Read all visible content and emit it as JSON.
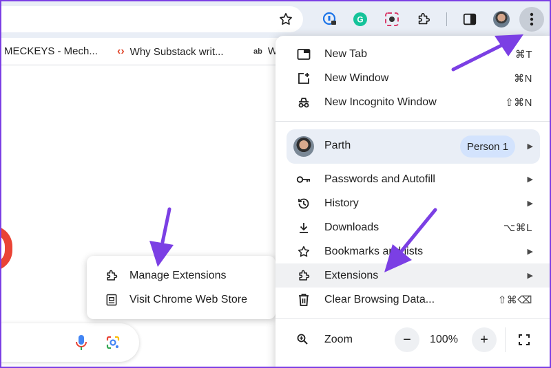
{
  "bookmarks": [
    {
      "label": "MECKEYS - Mech..."
    },
    {
      "label": "Why Substack writ..."
    },
    {
      "label": "W"
    }
  ],
  "extensions_submenu": {
    "items": [
      {
        "label": "Manage Extensions",
        "icon": "puzzle-icon"
      },
      {
        "label": "Visit Chrome Web Store",
        "icon": "web-store-icon"
      }
    ]
  },
  "menu": {
    "new_tab": {
      "label": "New Tab",
      "shortcut": "⌘T"
    },
    "new_window": {
      "label": "New Window",
      "shortcut": "⌘N"
    },
    "new_incognito": {
      "label": "New Incognito Window",
      "shortcut": "⇧⌘N"
    },
    "profile": {
      "name": "Parth",
      "badge": "Person 1"
    },
    "passwords": {
      "label": "Passwords and Autofill"
    },
    "history": {
      "label": "History"
    },
    "downloads": {
      "label": "Downloads",
      "shortcut": "⌥⌘L"
    },
    "bookmarks": {
      "label": "Bookmarks and lists"
    },
    "extensions": {
      "label": "Extensions"
    },
    "clear_data": {
      "label": "Clear Browsing Data...",
      "shortcut": "⇧⌘⌫"
    },
    "zoom": {
      "label": "Zoom",
      "minus": "−",
      "value": "100%",
      "plus": "+"
    }
  },
  "colors": {
    "annotation_arrow": "#7b3fe4",
    "highlight_row": "#f0f1f3",
    "profile_bg": "#e9eef6",
    "badge_bg": "#d3e3fd"
  }
}
